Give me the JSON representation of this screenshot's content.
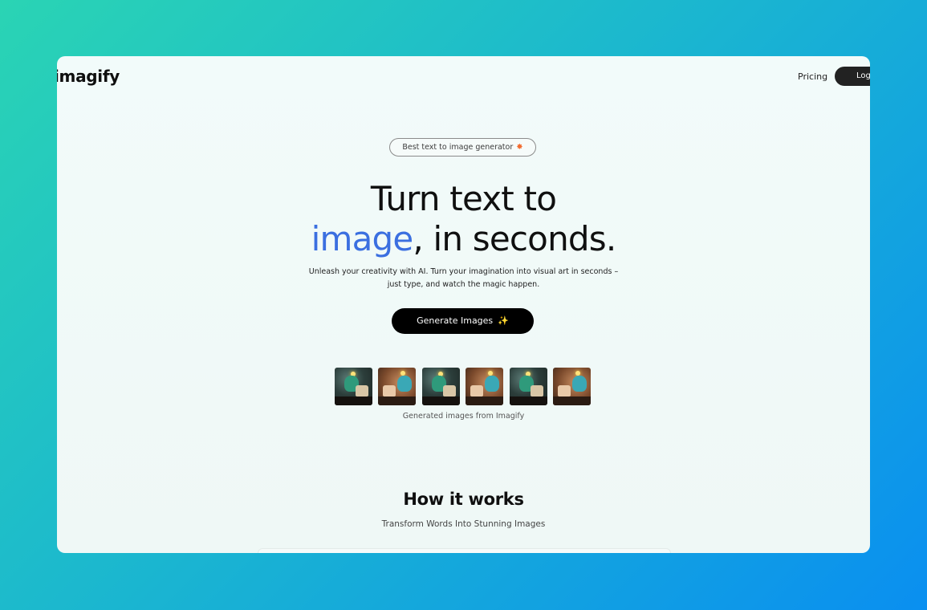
{
  "brand": {
    "name": "imagify"
  },
  "nav": {
    "pricing": "Pricing",
    "login": "Login"
  },
  "hero": {
    "badge_text": "Best text to image generator",
    "badge_icon": "✸",
    "headline_line1": "Turn text to",
    "headline_accent": "image",
    "headline_rest": ", in seconds.",
    "sub_line1": "Unleash your creativity with AI. Turn your imagination into visual art in seconds –",
    "sub_line2": "just type, and watch the magic happen.",
    "cta_label": "Generate Images",
    "cta_icon": "✨"
  },
  "gallery": {
    "caption": "Generated images from Imagify",
    "images": [
      {
        "style": "dark"
      },
      {
        "style": "warm"
      },
      {
        "style": "dark"
      },
      {
        "style": "warm"
      },
      {
        "style": "dark"
      },
      {
        "style": "warm"
      }
    ]
  },
  "how_it_works": {
    "title": "How it works",
    "subtitle": "Transform Words Into Stunning Images"
  },
  "colors": {
    "accent": "#3b6fe0",
    "button_bg": "#000000",
    "badge_star": "#f26a2e"
  }
}
